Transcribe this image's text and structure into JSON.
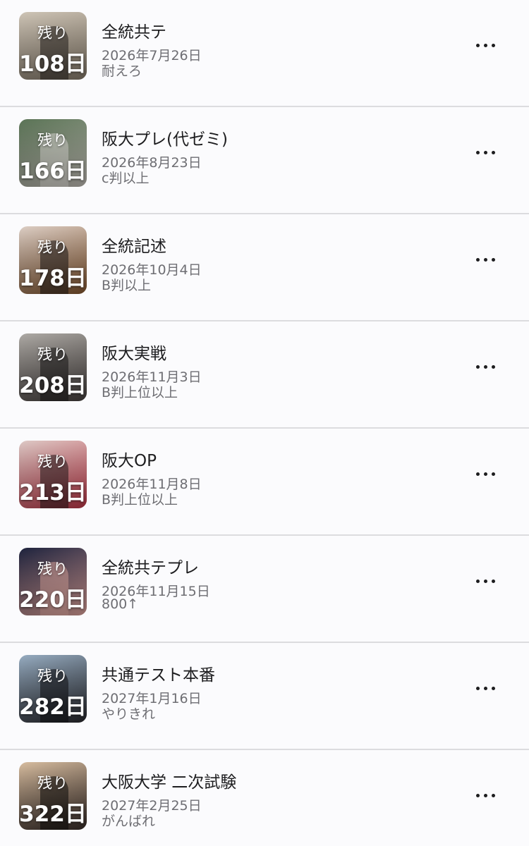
{
  "events": [
    {
      "remain_label": "残り",
      "days": "108日",
      "title": "全統共テ",
      "date": "2026年7月26日",
      "note": "耐えろ",
      "thumb_colors": [
        "#d9cfc0",
        "#8b7f6f"
      ]
    },
    {
      "remain_label": "残り",
      "days": "166日",
      "title": "阪大プレ(代ゼミ)",
      "date": "2026年8月23日",
      "note": "c判以上",
      "thumb_colors": [
        "#5f7a5a",
        "#c9c4bd"
      ]
    },
    {
      "remain_label": "残り",
      "days": "178日",
      "title": "全統記述",
      "date": "2026年10月4日",
      "note": "B判以上",
      "thumb_colors": [
        "#e8d9cf",
        "#8a5a32"
      ]
    },
    {
      "remain_label": "残り",
      "days": "208日",
      "title": "阪大実戦",
      "date": "2026年11月3日",
      "note": "B判上位以上",
      "thumb_colors": [
        "#b7b3ae",
        "#4a4442"
      ]
    },
    {
      "remain_label": "残り",
      "days": "213日",
      "title": "阪大OP",
      "date": "2026年11月8日",
      "note": "B判上位以上",
      "thumb_colors": [
        "#c7394a",
        "#e9d4d0"
      ]
    },
    {
      "remain_label": "残り",
      "days": "220日",
      "title": "全統共テプレ",
      "date": "2026年11月15日",
      "note": "800↑",
      "thumb_colors": [
        "#1e2440",
        "#e7a9a2"
      ]
    },
    {
      "remain_label": "残り",
      "days": "282日",
      "title": "共通テスト本番",
      "date": "2027年1月16日",
      "note": "やりきれ",
      "thumb_colors": [
        "#9fb6cc",
        "#2b2b30"
      ]
    },
    {
      "remain_label": "残り",
      "days": "322日",
      "title": "大阪大学 二次試験",
      "date": "2027年2月25日",
      "note": "がんばれ",
      "thumb_colors": [
        "#3a2e2a",
        "#e3c7a8"
      ]
    }
  ],
  "more_icon": "ellipsis-icon"
}
